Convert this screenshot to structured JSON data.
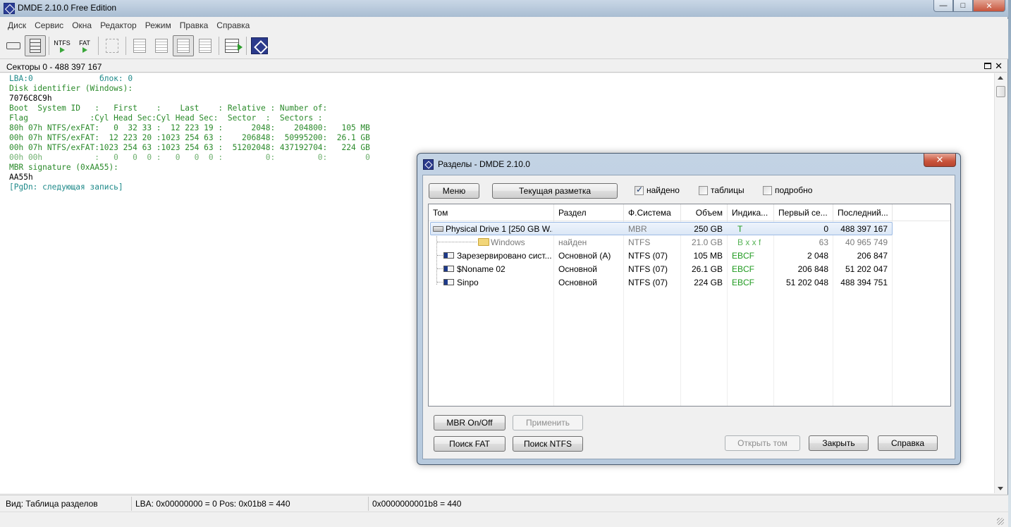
{
  "window": {
    "title": "DMDE 2.10.0 Free Edition",
    "controls": {
      "minimize": "—",
      "maximize": "□",
      "close": "✕"
    }
  },
  "menu": [
    "Диск",
    "Сервис",
    "Окна",
    "Редактор",
    "Режим",
    "Правка",
    "Справка"
  ],
  "toolbar": {
    "ntfs_label": "NTFS",
    "fat_label": "FAT"
  },
  "panel": {
    "title": "Секторы 0 - 488 397 167",
    "max_icon": "maximize-icon",
    "close_icon": "✕"
  },
  "editor": {
    "lines": [
      {
        "t": "LBA:0              блок: 0",
        "c": "teal"
      },
      {
        "t": "Disk identifier (Windows):",
        "c": "green"
      },
      {
        "t": "7076C8C9h",
        "c": "black"
      },
      {
        "t": "Boot  System ID   :   First    :    Last    : Relative : Number of:",
        "c": "green"
      },
      {
        "t": "Flag             :Cyl Head Sec:Cyl Head Sec:  Sector  :  Sectors :",
        "c": "green"
      },
      {
        "t": "80h 07h NTFS/exFAT:   0  32 33 :  12 223 19 :      2048:    204800:   105 MB",
        "c": "green"
      },
      {
        "t": "00h 07h NTFS/exFAT:  12 223 20 :1023 254 63 :    206848:  50995200:  26.1 GB",
        "c": "green"
      },
      {
        "t": "00h 07h NTFS/exFAT:1023 254 63 :1023 254 63 :  51202048: 437192704:   224 GB",
        "c": "green"
      },
      {
        "t": "00h 00h           :   0   0  0 :   0   0  0 :         0:         0:        0",
        "c": "ltgreen"
      },
      {
        "t": "MBR signature (0xAA55):",
        "c": "green"
      },
      {
        "t": "AA55h",
        "c": "black"
      },
      {
        "t": "[PgDn: следующая запись]",
        "c": "teal"
      }
    ]
  },
  "status": {
    "view": "Вид: Таблица разделов",
    "lba": "LBA: 0x00000000 = 0  Pos: 0x01b8 = 440",
    "hex": "0x0000000001b8 = 440"
  },
  "dialog": {
    "title": "Разделы - DMDE 2.10.0",
    "close_icon": "✕",
    "menu_button": "Меню",
    "layout_button": "Текущая разметка",
    "checks": [
      {
        "label": "найдено",
        "checked": true
      },
      {
        "label": "таблицы",
        "checked": false
      },
      {
        "label": "подробно",
        "checked": false
      }
    ],
    "columns": [
      "Том",
      "Раздел",
      "Ф.Система",
      "Объем",
      "Индика...",
      "Первый се...",
      "Последний..."
    ],
    "rows": [
      {
        "name": "Physical Drive 1 [250 GB W...",
        "part": "",
        "fs": "MBR",
        "size": "250 GB",
        "ind": "T",
        "first": "0",
        "last": "488 397 167",
        "icon": "hdd-icon",
        "style": "sel"
      },
      {
        "name": "Windows",
        "part": "найден",
        "fs": "NTFS",
        "size": "21.0 GB",
        "ind": "B x x f",
        "first": "63",
        "last": "40 965 749",
        "icon": "folder-icon",
        "style": "gray"
      },
      {
        "name": "Зарезервировано сист...",
        "part": "Основной (A)",
        "fs": "NTFS (07)",
        "size": "105 MB",
        "ind": "EBCF",
        "first": "2 048",
        "last": "206 847",
        "icon": "partition-icon",
        "style": "normal"
      },
      {
        "name": "$Noname 02",
        "part": "Основной",
        "fs": "NTFS (07)",
        "size": "26.1 GB",
        "ind": "EBCF",
        "first": "206 848",
        "last": "51 202 047",
        "icon": "partition-icon",
        "style": "normal"
      },
      {
        "name": "Sinpo",
        "part": "Основной",
        "fs": "NTFS (07)",
        "size": "224 GB",
        "ind": "EBCF",
        "first": "51 202 048",
        "last": "488 394 751",
        "icon": "partition-icon",
        "style": "normal"
      }
    ],
    "buttons": {
      "mbr": "MBR On/Off",
      "apply": "Применить",
      "find_fat": "Поиск FAT",
      "find_ntfs": "Поиск NTFS",
      "open": "Открыть том",
      "close": "Закрыть",
      "help": "Справка"
    }
  }
}
